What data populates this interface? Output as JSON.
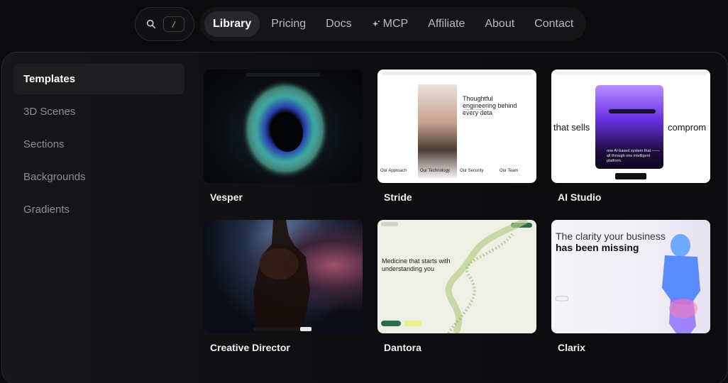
{
  "search": {
    "shortcut": "/"
  },
  "nav": {
    "items": [
      {
        "label": "Library",
        "active": true
      },
      {
        "label": "Pricing"
      },
      {
        "label": "Docs"
      },
      {
        "label": "MCP",
        "icon": "sparkle-icon"
      },
      {
        "label": "Affiliate"
      },
      {
        "label": "About"
      },
      {
        "label": "Contact"
      }
    ]
  },
  "sidebar": {
    "items": [
      {
        "label": "Templates",
        "active": true
      },
      {
        "label": "3D Scenes"
      },
      {
        "label": "Sections"
      },
      {
        "label": "Backgrounds"
      },
      {
        "label": "Gradients"
      }
    ]
  },
  "templates": [
    {
      "title": "Vesper"
    },
    {
      "title": "Stride",
      "headline": "Thoughtful engineering behind every deta",
      "cols": [
        "Our Approach",
        "Our Technology",
        "Our Security",
        "Our Team"
      ]
    },
    {
      "title": "AI Studio",
      "left_text": "that sells",
      "right_text": "comprom",
      "body": "one AI-based system that —— all through one intelligent platform."
    },
    {
      "title": "Creative Director"
    },
    {
      "title": "Dantora",
      "headline": "Medicine that starts with understanding you"
    },
    {
      "title": "Clarix",
      "headline": "The clarity your business",
      "subhead": "has been missing"
    }
  ],
  "colors": {
    "accent_purple": "#7b3cf0",
    "dantora_green": "#2d6b4a"
  }
}
